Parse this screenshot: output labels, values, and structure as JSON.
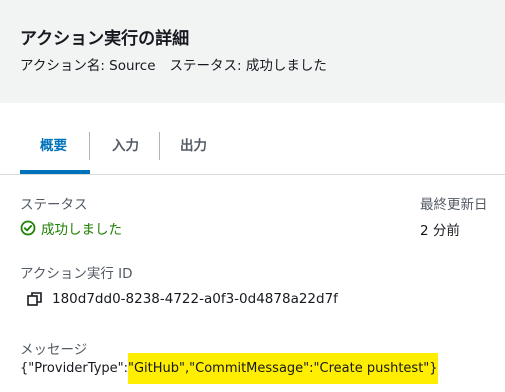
{
  "header": {
    "title": "アクション実行の詳細",
    "action_name": "アクション名: Source",
    "status_text": "ステータス: 成功しました"
  },
  "tabs": [
    {
      "label": "概要",
      "active": true
    },
    {
      "label": "入力",
      "active": false
    },
    {
      "label": "出力",
      "active": false
    }
  ],
  "summary": {
    "status_label": "ステータス",
    "status_value": "成功しました",
    "status_icon": "check-circle-icon",
    "updated_label": "最終更新日",
    "updated_value": "2 分前",
    "exec_id_label": "アクション実行 ID",
    "exec_id_value": "180d7dd0-8238-4722-a0f3-0d4878a22d7f",
    "message_label": "メッセージ",
    "message_prefix": "{\"ProviderType\":",
    "message_highlight": "\"GitHub\",\"CommitMessage\":\"Create pushtest\"}"
  },
  "colors": {
    "accent": "#0073bb",
    "success": "#1d8102",
    "highlight": "#ffee00",
    "header_bg": "#f2f3f3"
  }
}
